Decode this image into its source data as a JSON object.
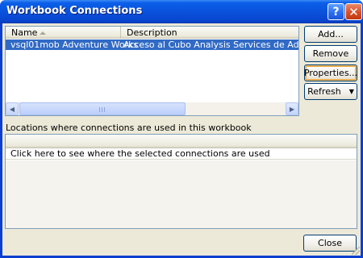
{
  "window": {
    "title": "Workbook Connections"
  },
  "connections": {
    "columns": [
      "Name",
      "Description"
    ],
    "rows": [
      {
        "name": "vsql01mob Adventure Works",
        "description": "Acceso al Cubo Analysis Services de Adventure Works"
      }
    ]
  },
  "buttons": {
    "add": "Add...",
    "remove": "Remove",
    "properties": "Properties...",
    "refresh": "Refresh",
    "close": "Close"
  },
  "locations": {
    "label": "Locations where connections are used in this workbook",
    "prompt": "Click here to see where the selected connections are used"
  }
}
